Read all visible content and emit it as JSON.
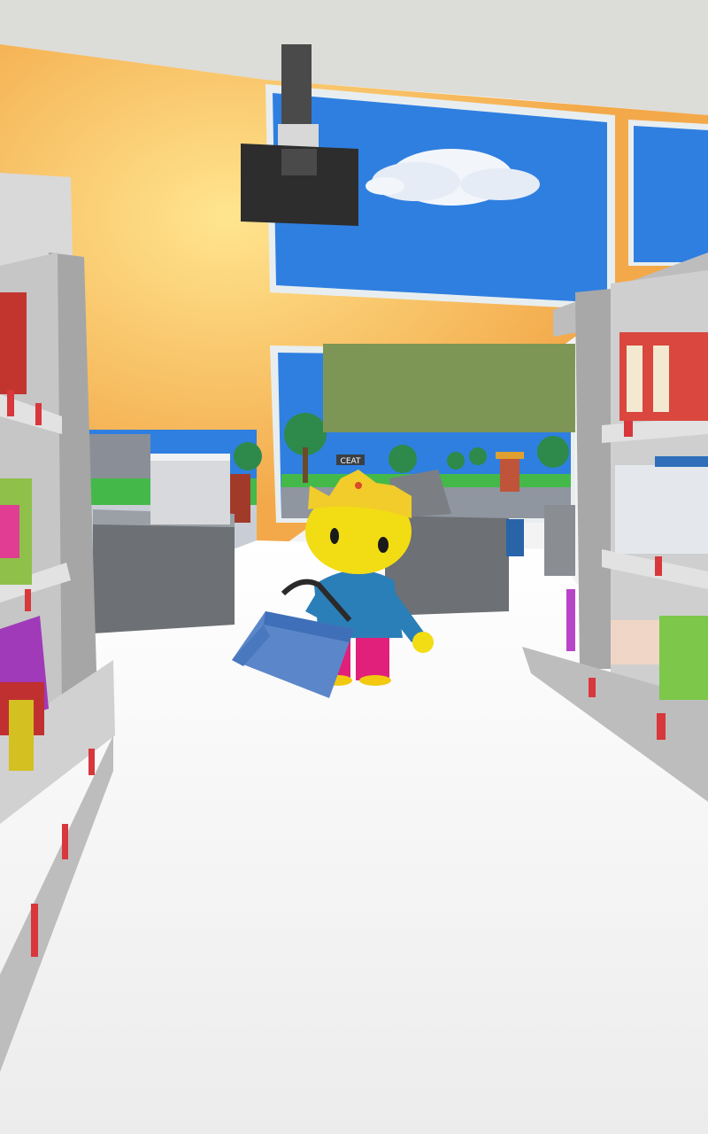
{
  "scene": {
    "description_label": "",
    "store_sign_text": "CEAT",
    "colors": {
      "ceiling": "#d9d9d6",
      "wall_orange": "#f3a94a",
      "wall_glow": "#ffe08a",
      "sky": "#2f7fe0",
      "floor": "#f6f6f6",
      "shelf": "#bdbdbd",
      "shelf_dark": "#9a9a9a",
      "banner": "#7e9655",
      "grass": "#44b94a",
      "price_tag": "#d8373b",
      "character_skin": "#f2dc14",
      "character_shirt": "#2b7fb8",
      "character_pants": "#e0207a",
      "crown": "#f1cc2a",
      "basket": "#5b86c9"
    },
    "icons": {
      "camera": "security-camera-icon",
      "cloud": "cloud-icon",
      "character": "crowned-character-icon",
      "basket": "shopping-basket-icon"
    }
  }
}
